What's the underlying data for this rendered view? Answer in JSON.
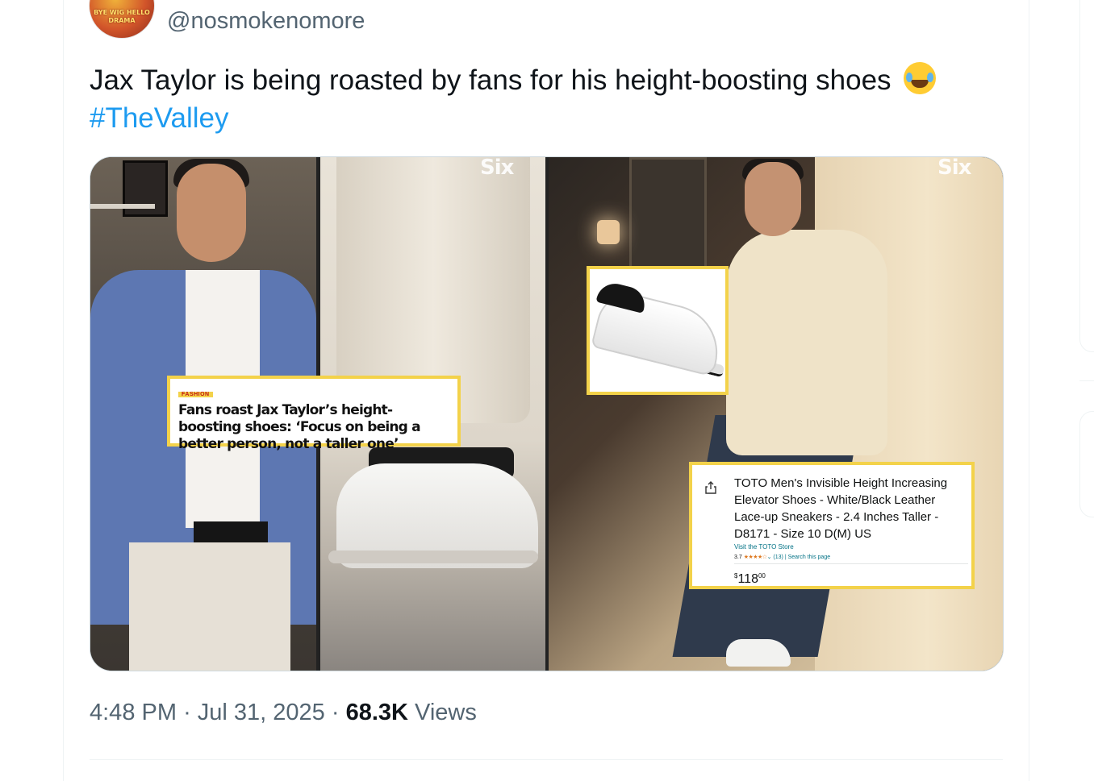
{
  "tweet": {
    "avatar_text": "BYE WIG HELLO DRAMA",
    "handle": "@nosmokenomore",
    "text": "Jax Taylor is being roasted by fans for his height-boosting shoes",
    "emoji": "face-with-tears-of-joy",
    "hashtag": "#TheValley",
    "time": "4:48 PM",
    "date": "Jul 31, 2025",
    "views_count": "68.3K",
    "views_label": "Views"
  },
  "media": {
    "watermark": "Six",
    "headline_tag": "FASHION",
    "headline": "Fans roast Jax Taylor’s height-boosting shoes: ‘Focus on being a better person, not a taller one’",
    "product": {
      "title": "TOTO Men's Invisible Height Increasing Elevator Shoes - White/Black Leather Lace-up Sneakers - 2.4 Inches Taller - D8171 - Size 10 D(M) US",
      "store_link": "Visit the TOTO Store",
      "rating": "3.7",
      "stars": "★★★★☆",
      "review_count": "(13)",
      "search_link": "Search this page",
      "price_symbol": "$",
      "price_whole": "118",
      "price_fraction": "00"
    }
  },
  "colors": {
    "link_blue": "#1d9bf0",
    "secondary_text": "#536471",
    "callout_yellow": "#f3d24a"
  }
}
